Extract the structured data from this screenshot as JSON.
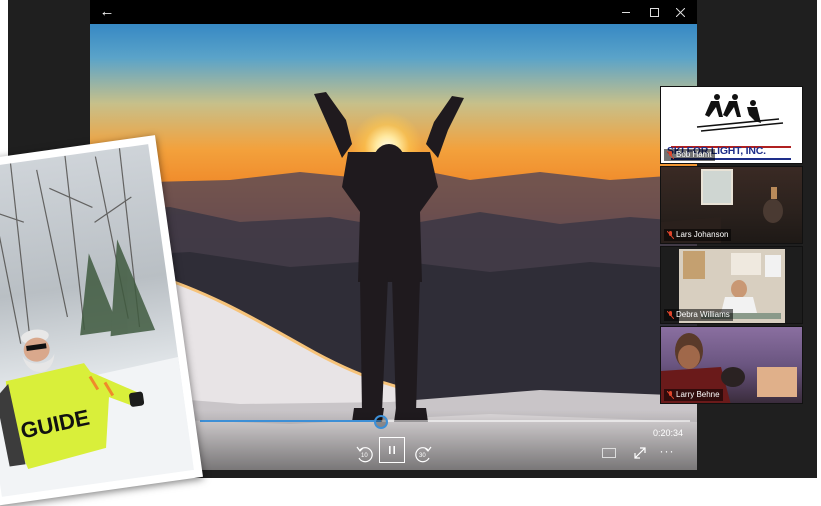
{
  "player": {
    "back_icon": "back-arrow-icon",
    "minimize_icon": "minimize-icon",
    "maximize_icon": "maximize-icon",
    "close_icon": "close-icon",
    "time": "0:20:34",
    "progress": 0.37,
    "rewind_label": "10",
    "forward_label": "30",
    "accent": "#3d8fd6"
  },
  "photo": {
    "vest_text": "GUIDE"
  },
  "participants": [
    {
      "name": "Bob Hamt",
      "muted": true,
      "logo_text": "SKI FOR LIGHT, INC."
    },
    {
      "name": "Lars Johanson",
      "muted": true
    },
    {
      "name": "Debra Williams",
      "muted": true
    },
    {
      "name": "Larry Behne",
      "muted": true
    }
  ],
  "colors": {
    "mute_icon": "#e0442a",
    "logo_blue": "#1e2e8a"
  }
}
